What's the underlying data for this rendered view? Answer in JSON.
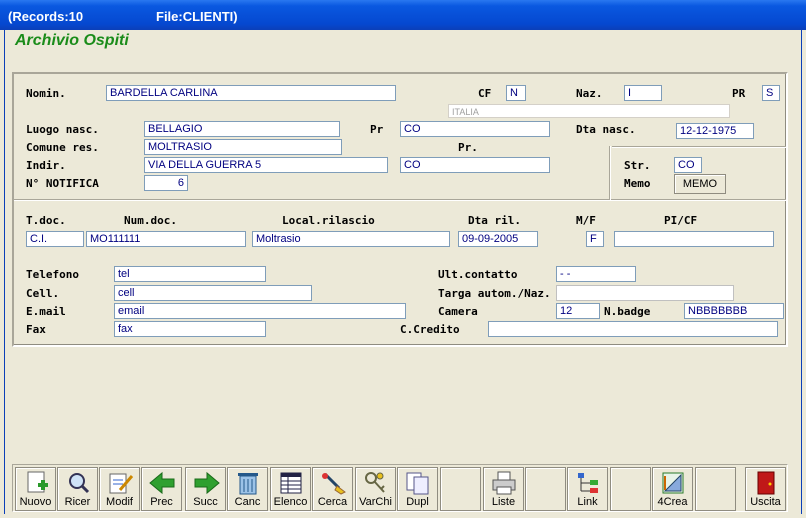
{
  "window": {
    "records": "(Records:10",
    "file": "File:CLIENTI)"
  },
  "app_title": "Archivio Ospiti",
  "form": {
    "nomin_label": "Nomin.",
    "nomin": "BARDELLA CARLINA",
    "cf_label": "CF",
    "cf": "N",
    "naz_label": "Naz.",
    "naz": "I",
    "naz_desc": "ITALIA",
    "pr_top_label": "PR",
    "pr_top": "S",
    "luogo_label": "Luogo nasc.",
    "luogo": "BELLAGIO",
    "pr1_label": "Pr",
    "pr1": "CO",
    "dta_nasc_label": "Dta nasc.",
    "dta_nasc": "12-12-1975",
    "comune_label": "Comune res.",
    "comune": "MOLTRASIO",
    "pr2_label": "Pr.",
    "indir_label": "Indir.",
    "indir": "VIA DELLA GUERRA 5",
    "indir_pr": "CO",
    "str_label": "Str.",
    "str": "CO",
    "memo_label": "Memo",
    "memo_button": "MEMO",
    "notifica_label": "N° NOTIFICA",
    "notifica": "6",
    "tdoc_label": "T.doc.",
    "tdoc": "C.I.",
    "numdoc_label": "Num.doc.",
    "numdoc": "MO111111",
    "local_label": "Local.rilascio",
    "local": "Moltrasio",
    "dtaril_label": "Dta ril.",
    "dtaril": "09-09-2005",
    "mf_label": "M/F",
    "mf": "F",
    "picf_label": "PI/CF",
    "picf": "",
    "tel_label": "Telefono",
    "tel": "tel",
    "cell_label": "Cell.",
    "cell": "cell",
    "email_label": "E.mail",
    "email": "email",
    "fax_label": "Fax",
    "fax": "fax",
    "ult_label": "Ult.contatto",
    "ult": "  -  -",
    "targa_label": "Targa autom./Naz.",
    "targa": "",
    "camera_label": "Camera",
    "camera": "12",
    "nbadge_label": "N.badge",
    "nbadge": "NBBBBBBB",
    "ccredito_label": "C.Credito",
    "ccredito": ""
  },
  "toolbar": [
    {
      "label": "Nuovo",
      "icon": "new-document-icon"
    },
    {
      "label": "Ricer",
      "icon": "magnifier-icon"
    },
    {
      "label": "Modif",
      "icon": "edit-document-icon"
    },
    {
      "label": "Prec",
      "icon": "arrow-left-icon"
    },
    {
      "label": "Succ",
      "icon": "arrow-right-icon"
    },
    {
      "label": "Canc",
      "icon": "trash-icon"
    },
    {
      "label": "Elenco",
      "icon": "list-icon"
    },
    {
      "label": "Cerca",
      "icon": "search-brush-icon"
    },
    {
      "label": "VarChi",
      "icon": "keys-icon"
    },
    {
      "label": "Dupl",
      "icon": "duplicate-icon"
    },
    {
      "label": "",
      "icon": ""
    },
    {
      "label": "Liste",
      "icon": "printer-icon"
    },
    {
      "label": "",
      "icon": ""
    },
    {
      "label": "Link",
      "icon": "tree-icon"
    },
    {
      "label": "",
      "icon": ""
    },
    {
      "label": "4Crea",
      "icon": "design-icon"
    },
    {
      "label": "",
      "icon": ""
    },
    {
      "label": "Uscita",
      "icon": "exit-door-icon"
    }
  ]
}
